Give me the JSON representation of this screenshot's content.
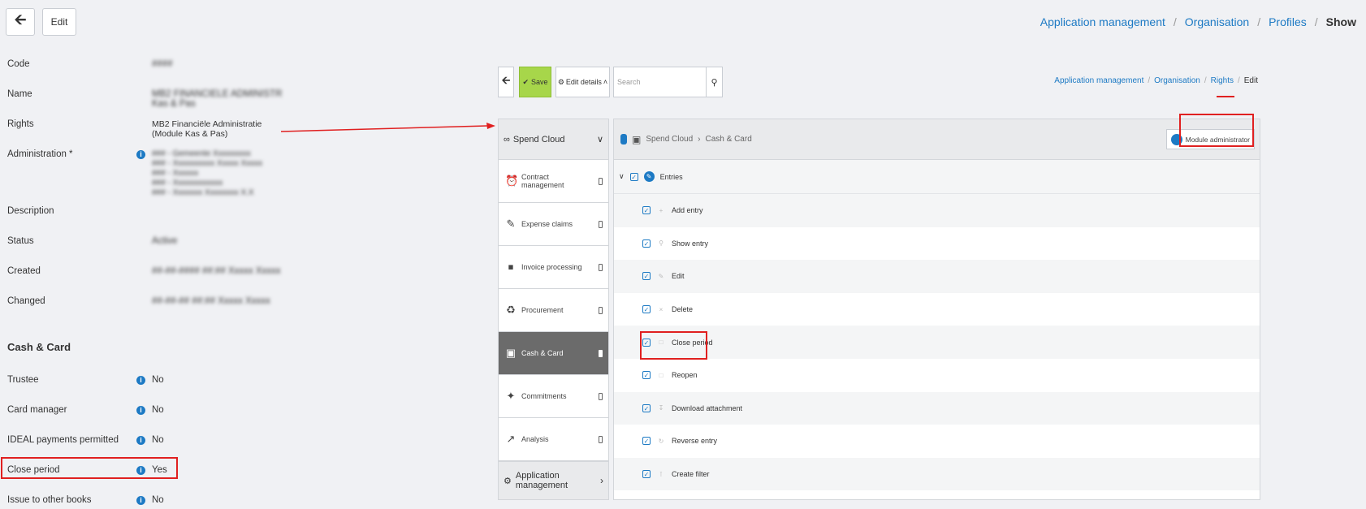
{
  "toolbar": {
    "back_icon": "arrow-left-icon",
    "edit_label": "Edit"
  },
  "breadcrumb": {
    "items": [
      "Application management",
      "Organisation",
      "Profiles"
    ],
    "current": "Show",
    "sep": "/"
  },
  "details": {
    "code_label": "Code",
    "code_value": "####",
    "name_label": "Name",
    "name_value_1": "MB2 FINANCIELE ADMINISTR",
    "name_value_2": "Kas & Pas",
    "rights_label": "Rights",
    "rights_value_1": "MB2 Financiële Administratie",
    "rights_value_2": "(Module Kas & Pas)",
    "admin_label": "Administration *",
    "admin_value_1": "### - Gemeente Xxxxxxxxx",
    "admin_value_2": "### - Xxxxxxxxxx Xxxxx Xxxxx",
    "admin_value_3": "### - Xxxxxx",
    "admin_value_4": "### - Xxxxxxxxxxxx",
    "admin_value_5": "### - Xxxxxxx Xxxxxxxx X.X",
    "description_label": "Description",
    "status_label": "Status",
    "status_value": "Active",
    "created_label": "Created",
    "created_value": "##-##-#### ##:## Xxxxx Xxxxx",
    "changed_label": "Changed",
    "changed_value": "##-##-## ##:## Xxxxx Xxxxx"
  },
  "cash_card": {
    "title": "Cash & Card",
    "trustee_label": "Trustee",
    "trustee_value": "No",
    "card_manager_label": "Card manager",
    "card_manager_value": "No",
    "ideal_label": "IDEAL payments permitted",
    "ideal_value": "No",
    "close_period_label": "Close period",
    "close_period_value": "Yes",
    "issue_label": "Issue to other books",
    "issue_value": "No"
  },
  "panel": {
    "save_label": "Save",
    "edit_details_label": "Edit details",
    "search_placeholder": "Search",
    "breadcrumb": [
      "Application management",
      "Organisation",
      "Rights"
    ],
    "breadcrumb_current": "Edit",
    "side_head": "Spend Cloud",
    "menu": [
      {
        "label": "Contract management",
        "icon": "alarm-clock-icon"
      },
      {
        "label": "Expense claims",
        "icon": "pencil-icon"
      },
      {
        "label": "Invoice processing",
        "icon": "stamp-icon"
      },
      {
        "label": "Procurement",
        "icon": "cart-icon"
      },
      {
        "label": "Cash & Card",
        "icon": "cash-card-icon"
      },
      {
        "label": "Commitments",
        "icon": "pin-icon"
      },
      {
        "label": "Analysis",
        "icon": "chart-icon"
      }
    ],
    "side_foot": "Application management",
    "main_crumb_1": "Spend Cloud",
    "main_crumb_2": "Cash & Card",
    "module_admin_label": "Module administrator",
    "entries_label": "Entries",
    "permissions": [
      "Add entry",
      "Show entry",
      "Edit",
      "Delete",
      "Close period",
      "Reopen",
      "Download attachment",
      "Reverse entry",
      "Create filter"
    ]
  },
  "colors": {
    "accent": "#1d7ac4",
    "save": "#a7d64a",
    "highlight": "#e02020",
    "active_menu": "#6b6b6b"
  }
}
